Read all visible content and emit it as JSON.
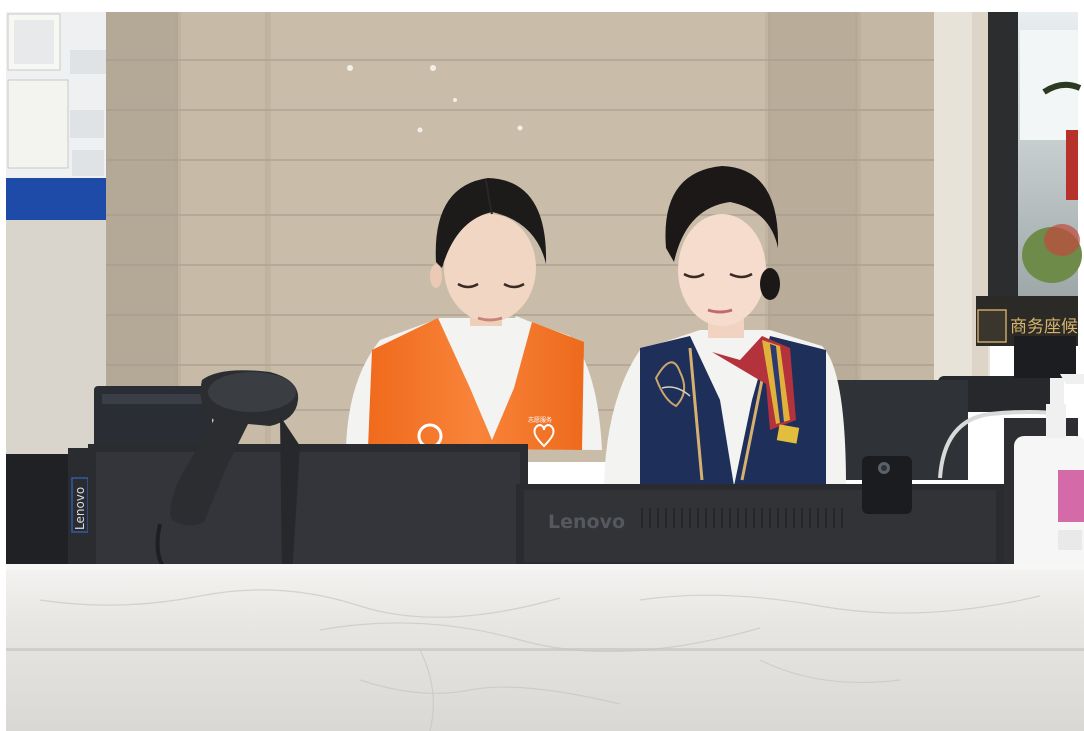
{
  "signage": {
    "lounge_sign": "商务座候",
    "volunteer_vest_text": "志愿服务"
  },
  "brands": {
    "tower_pc": "Lenovo",
    "monitor": "Lenovo"
  },
  "colors": {
    "marble_wall": "#c4b6a3",
    "marble_stripe": "#a8998a",
    "vest_orange": "#f47a2a",
    "uniform_navy": "#1e2f5a",
    "shirt_white": "#f3f3f1",
    "counter_marble": "#ebeae8",
    "monitor_black": "#2a2b2e",
    "notice_board_blue": "#1e4aa8"
  },
  "icons": {
    "barcode_scanner": "barcode-scanner-icon",
    "heart_logo": "heart-icon",
    "camera": "camera-icon"
  }
}
